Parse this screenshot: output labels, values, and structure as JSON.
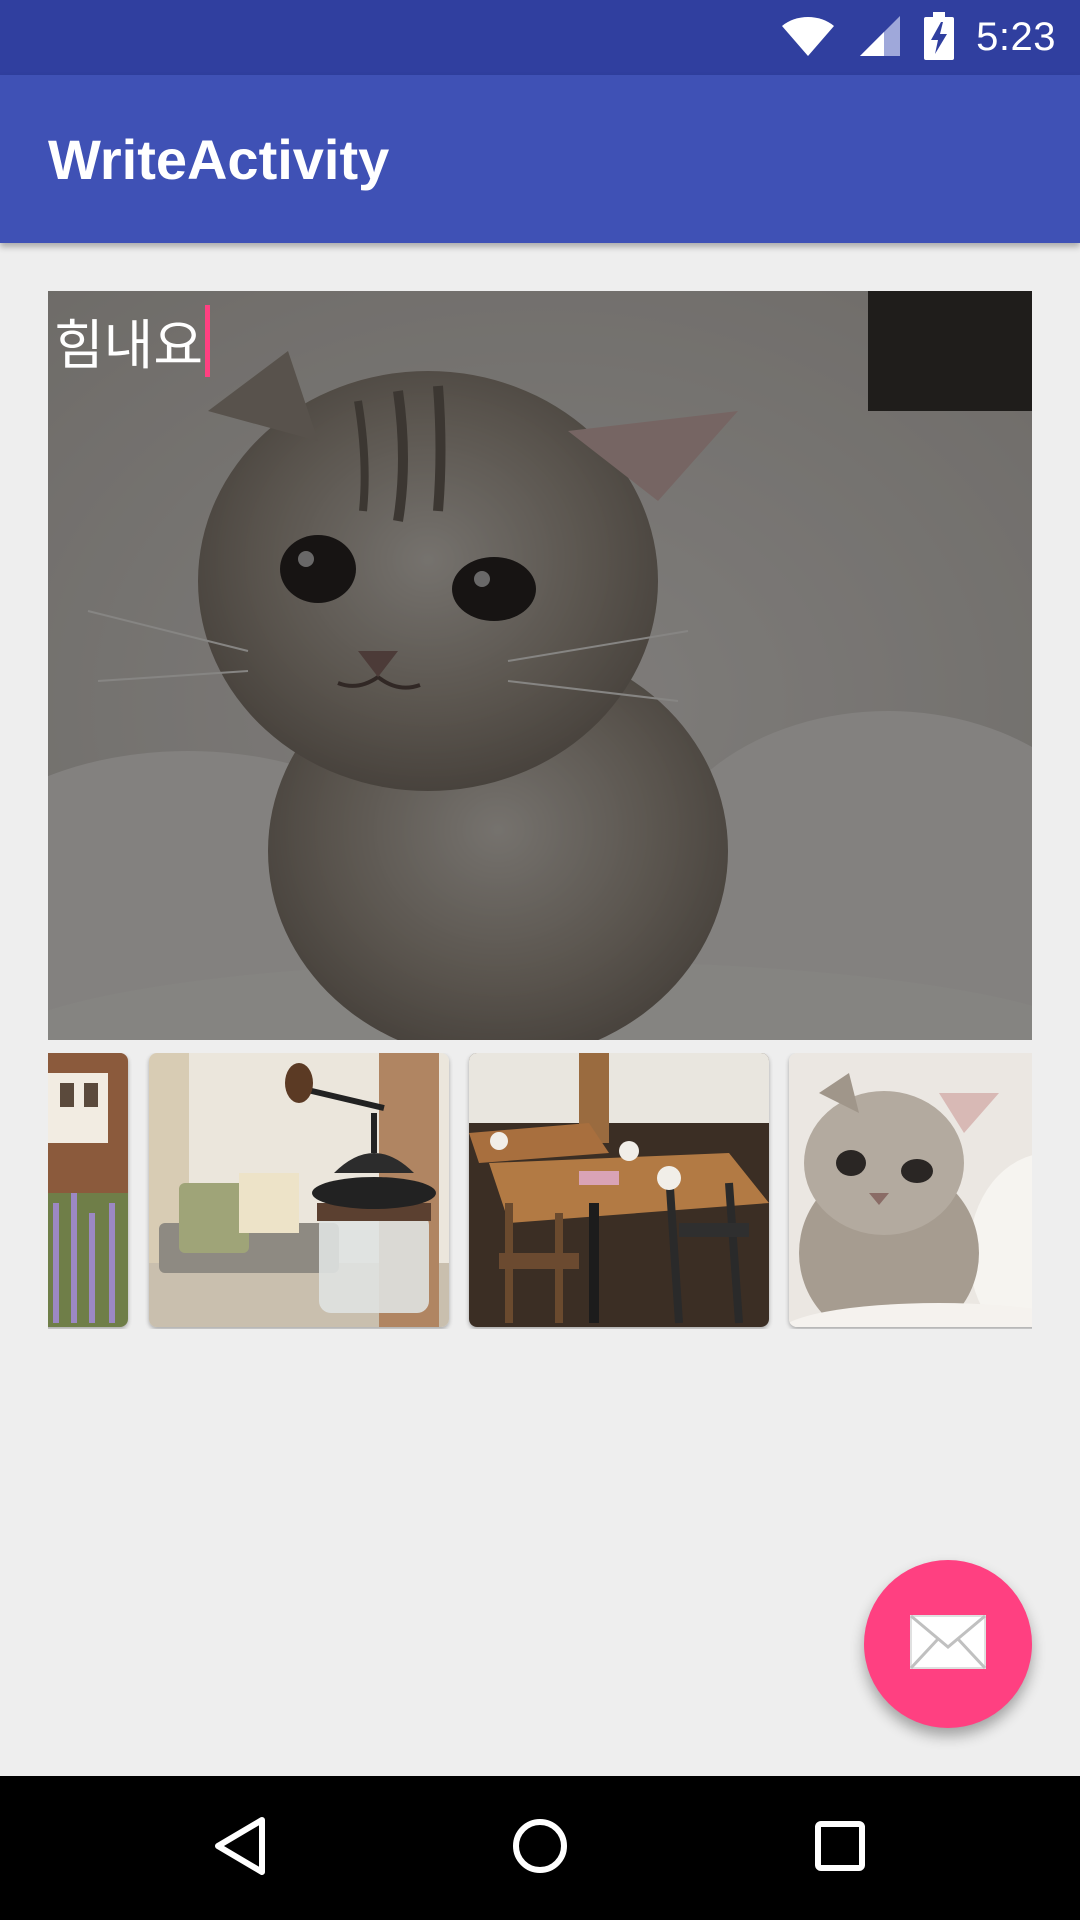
{
  "status_bar": {
    "time": "5:23",
    "icons": [
      "wifi-icon",
      "cell-signal-icon",
      "battery-charging-icon"
    ],
    "color": "#303f9f"
  },
  "app_bar": {
    "title": "WriteActivity",
    "color": "#3f51b5"
  },
  "editor": {
    "caption_text": "힘내요",
    "cursor_color": "#ff4081",
    "background_image": "kitten-photo"
  },
  "thumbnails": [
    {
      "name": "lavender-house-photo"
    },
    {
      "name": "coffee-grinder-photo"
    },
    {
      "name": "cafe-tables-photo"
    },
    {
      "name": "kitten-photo"
    }
  ],
  "fab": {
    "icon": "mail-icon",
    "color": "#ff4081"
  },
  "nav_bar": {
    "buttons": [
      "back-icon",
      "home-icon",
      "recents-icon"
    ]
  }
}
